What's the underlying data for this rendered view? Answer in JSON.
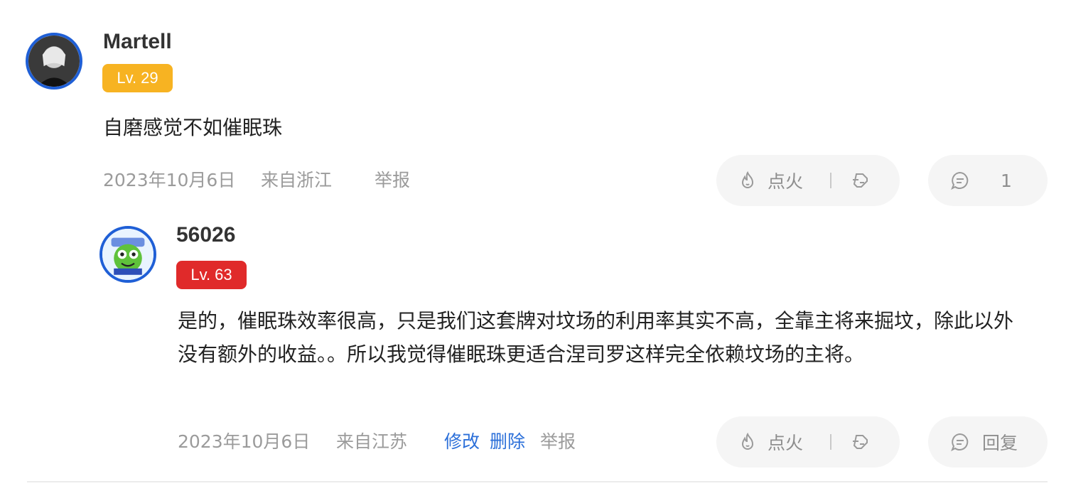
{
  "comment": {
    "username": "Martell",
    "level": "Lv. 29",
    "text": "自磨感觉不如催眠珠",
    "date": "2023年10月6日",
    "location": "来自浙江",
    "report_label": "举报",
    "fire_label": "点火",
    "reply_count": "1",
    "badge_color": "#f7b322"
  },
  "reply": {
    "username": "56026",
    "level": "Lv. 63",
    "text": "是的，催眠珠效率很高，只是我们这套牌对坟场的利用率其实不高，全靠主将来掘坟，除此以外没有额外的收益。。所以我觉得催眠珠更适合涅司罗这样完全依赖坟场的主将。",
    "date": "2023年10月6日",
    "location": "来自江苏",
    "edit_label": "修改",
    "delete_label": "删除",
    "report_label": "举报",
    "fire_label": "点火",
    "reply_label": "回复",
    "badge_color": "#e02a2a"
  },
  "colors": {
    "link": "#2b6fd9",
    "avatar_border": "#1f5fd6",
    "pill_bg": "#f5f5f5"
  }
}
